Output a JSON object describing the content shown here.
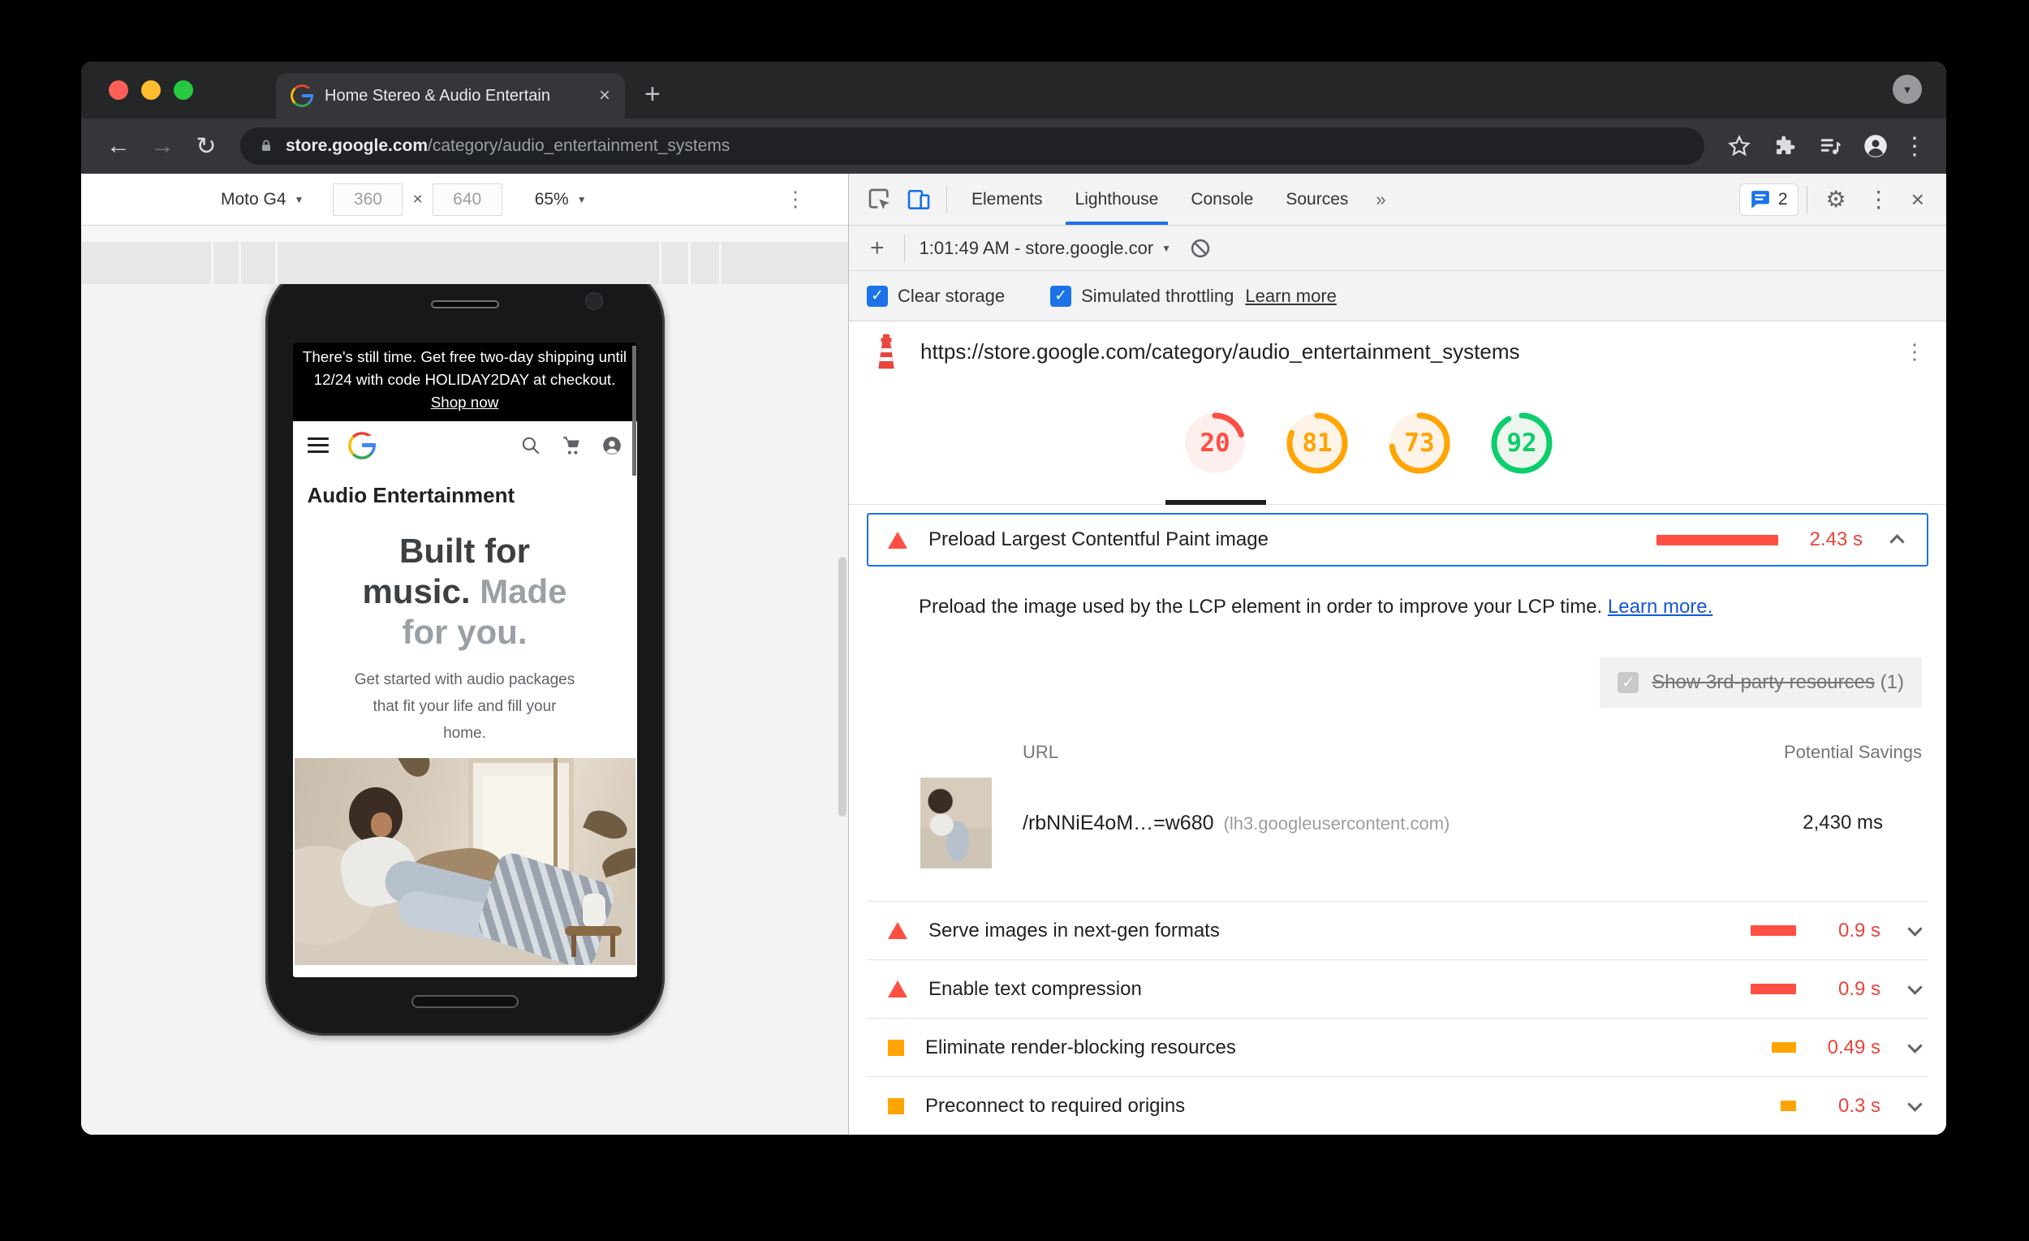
{
  "glyphs": {
    "plus": "+",
    "close_x": "×",
    "chevron_down": "▼",
    "back_arrow": "←",
    "forward_arrow": "→",
    "reload": "↻",
    "more_vertical": "⋮",
    "overflow": "»",
    "gear": "⚙",
    "multiply": "×",
    "check": "✓"
  },
  "browser": {
    "tab_title": "Home Stereo & Audio Entertain",
    "url": {
      "domain": "store.google.com",
      "path": "/category/audio_entertainment_systems"
    }
  },
  "device_toolbar": {
    "device": "Moto G4",
    "width": "360",
    "height": "640",
    "zoom": "65%"
  },
  "phone_page": {
    "banner_text": "There's still time. Get free two-day shipping until 12/24 with code HOLIDAY2DAY at checkout.",
    "banner_link": "Shop now",
    "category_title": "Audio Entertainment",
    "hero_lines": [
      {
        "dark": "Built for",
        "light": ""
      },
      {
        "dark": "music.",
        "light": " Made"
      },
      {
        "dark": "",
        "light": "for you."
      }
    ],
    "hero_subtitle": "Get started with audio packages that fit your life and fill your home."
  },
  "devtools": {
    "tabs": [
      "Elements",
      "Lighthouse",
      "Console",
      "Sources"
    ],
    "issues_count": "2",
    "run_label": "1:01:49 AM - store.google.cor",
    "clear_storage_label": "Clear storage",
    "throttling_label": "Simulated throttling",
    "learn_more_label": "Learn more"
  },
  "lighthouse": {
    "report_url": "https://store.google.com/category/audio_entertainment_systems",
    "scores": [
      {
        "value": "20",
        "rating": "fail"
      },
      {
        "value": "81",
        "rating": "average"
      },
      {
        "value": "73",
        "rating": "average"
      },
      {
        "value": "92",
        "rating": "pass"
      }
    ],
    "colors": {
      "fail": "#ff4e42",
      "average": "#ffa400",
      "pass": "#0cce6b",
      "fail_bg": "#fdefed",
      "average_bg": "#fdf3e7",
      "pass_bg": "#eef5ef",
      "fail_text": "#e8443a",
      "accent": "#1a73e8"
    },
    "expanded_audit": {
      "title": "Preload Largest Contentful Paint image",
      "savings": "2.43 s",
      "rating": "fail",
      "description": "Preload the image used by the LCP element in order to improve your LCP time.",
      "learn_more": "Learn more.",
      "third_party": {
        "label": "Show 3rd-party resources",
        "count": "(1)"
      },
      "table": {
        "url_header": "URL",
        "savings_header": "Potential Savings",
        "rows": [
          {
            "url": "/rbNNiE4oM…=w680",
            "host": "(lh3.googleusercontent.com)",
            "savings": "2,430 ms"
          }
        ]
      }
    },
    "audits": [
      {
        "title": "Serve images in next-gen formats",
        "savings": "0.9 s",
        "rating": "fail"
      },
      {
        "title": "Enable text compression",
        "savings": "0.9 s",
        "rating": "fail"
      },
      {
        "title": "Eliminate render-blocking resources",
        "savings": "0.49 s",
        "rating": "average"
      },
      {
        "title": "Preconnect to required origins",
        "savings": "0.3 s",
        "rating": "average"
      }
    ]
  }
}
